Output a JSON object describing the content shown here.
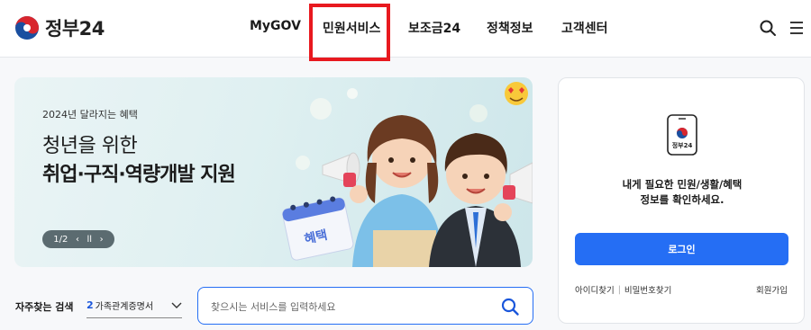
{
  "header": {
    "logo_text": "정부24",
    "nav": [
      "MyGOV",
      "민원서비스",
      "보조금24",
      "정책정보",
      "고객센터"
    ],
    "highlighted_nav": "민원서비스"
  },
  "banner": {
    "subtitle": "2024년 달라지는 혜택",
    "title_line1": "청년을 위한",
    "title_line2": "취업·구직·역량개발 지원",
    "pager": "1/2",
    "calendar_label": "혜택"
  },
  "search": {
    "freq_label": "자주찾는 검색",
    "freq_number": "2",
    "freq_value": "가족관계증명서",
    "placeholder": "찾으시는 서비스를 입력하세요"
  },
  "login": {
    "app_label": "정부24",
    "message_line1": "내게 필요한 민원/생활/혜택",
    "message_line2": "정보를 확인하세요.",
    "login_button": "로그인",
    "find_id": "아이디찾기",
    "find_pw": "비밀번호찾기",
    "join": "회원가입"
  },
  "colors": {
    "accent": "#256ef4",
    "highlight": "#e8191f",
    "banner_bg": "#dff0f1"
  }
}
